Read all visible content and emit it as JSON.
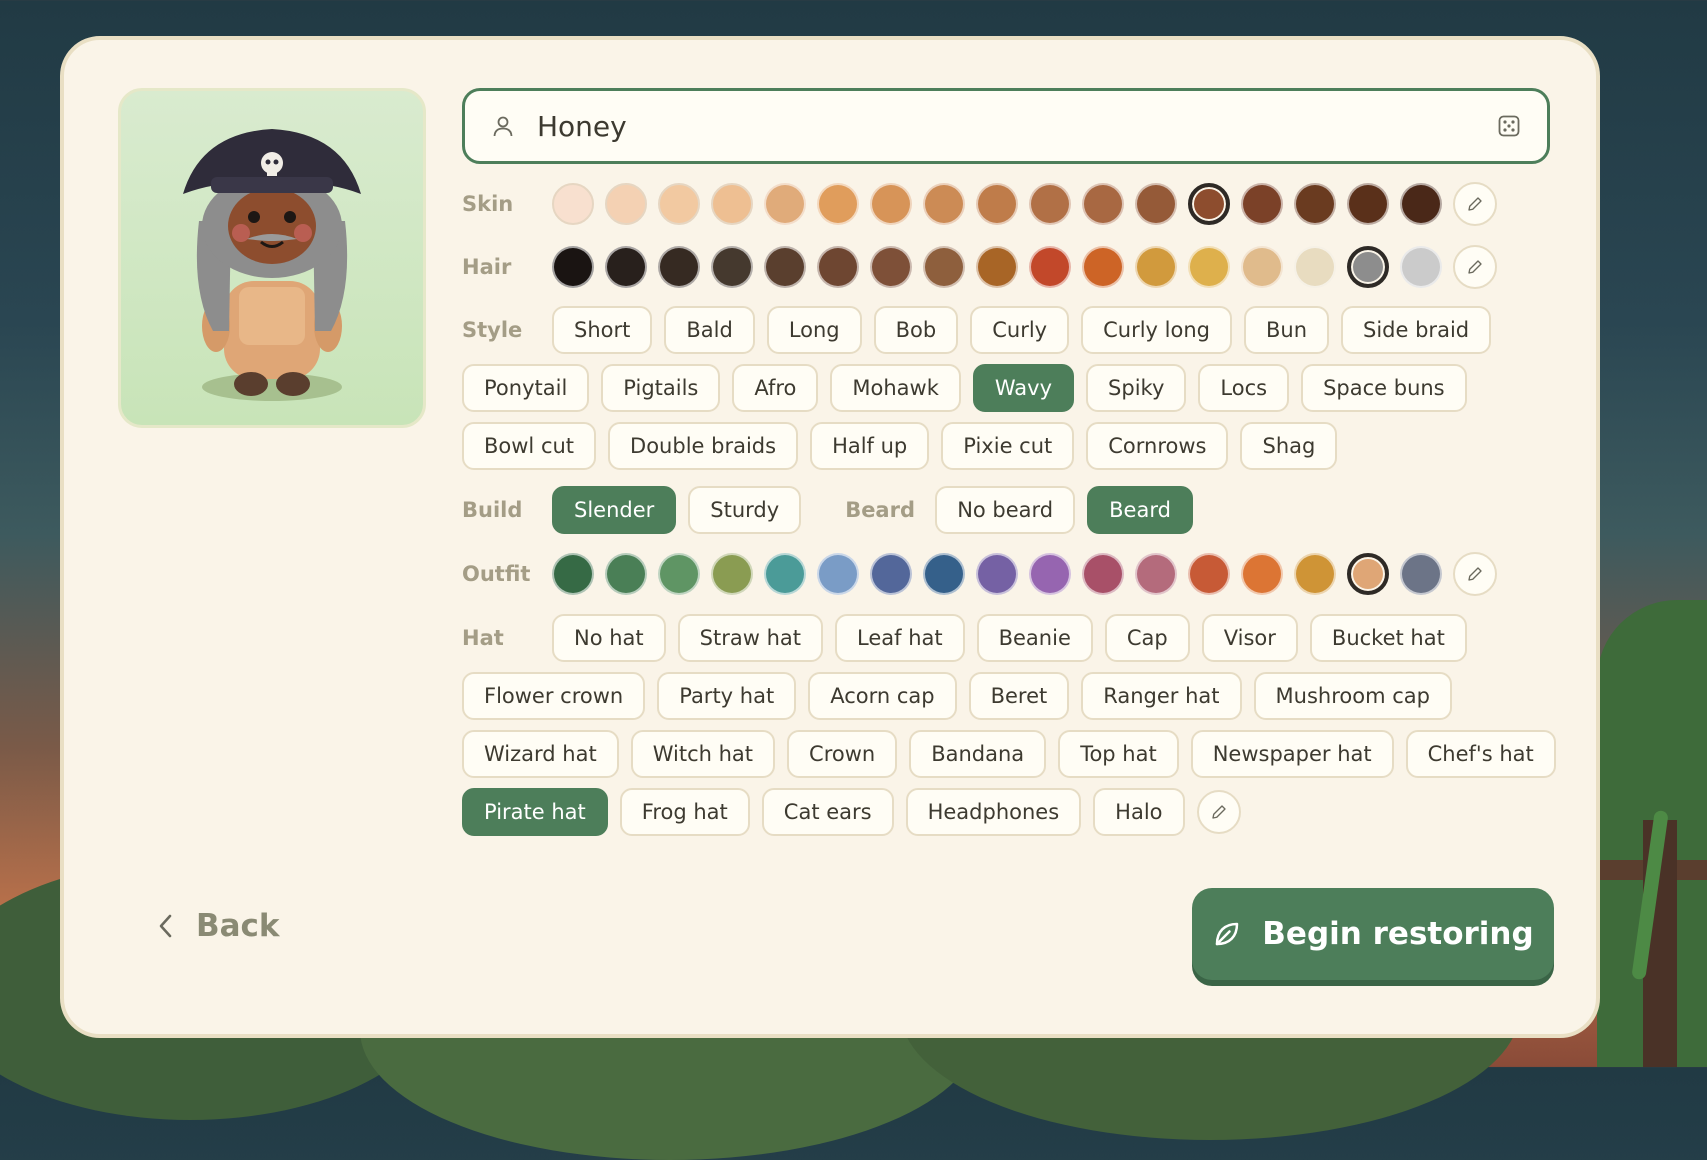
{
  "name": {
    "value": "Honey"
  },
  "skin": {
    "label": "Skin",
    "colors": [
      "#f8e0cf",
      "#f4d1b3",
      "#f2c9a1",
      "#eebf92",
      "#e0ab7a",
      "#e09d5c",
      "#d79458",
      "#cc8b55",
      "#bf7c4a",
      "#b17046",
      "#a86842",
      "#955a38",
      "#8d4d2e",
      "#7b4128",
      "#6a3b20",
      "#5a301a",
      "#4a2818"
    ],
    "selected": 12
  },
  "hair": {
    "label": "Hair",
    "colors": [
      "#1a1412",
      "#28201c",
      "#362a22",
      "#45392e",
      "#5a3f2e",
      "#6e4631",
      "#7e5038",
      "#8e5f3d",
      "#a86526",
      "#c2482a",
      "#cd6426",
      "#d19a3d",
      "#deb04c",
      "#e0bb8c",
      "#e8dcc0",
      "#8d8d8d",
      "#cbcbcb"
    ],
    "selected": 15
  },
  "style": {
    "label": "Style",
    "rows": [
      [
        "Short",
        "Bald",
        "Long",
        "Bob",
        "Curly",
        "Curly long",
        "Bun",
        "Side braid"
      ],
      [
        "Ponytail",
        "Pigtails",
        "Afro",
        "Mohawk",
        "Wavy",
        "Spiky",
        "Locs",
        "Space buns"
      ],
      [
        "Bowl cut",
        "Double braids",
        "Half up",
        "Pixie cut",
        "Cornrows",
        "Shag"
      ]
    ],
    "selected": "Wavy"
  },
  "build": {
    "label": "Build",
    "options": [
      "Slender",
      "Sturdy"
    ],
    "selected": "Slender"
  },
  "beard": {
    "label": "Beard",
    "options": [
      "No beard",
      "Beard"
    ],
    "selected": "Beard"
  },
  "outfit": {
    "label": "Outfit",
    "colors": [
      "#366a45",
      "#4a7f56",
      "#5f9564",
      "#8a9c52",
      "#4b9b98",
      "#7a9cc6",
      "#53679a",
      "#35608a",
      "#7561a4",
      "#9665b0",
      "#a85068",
      "#b46b7c",
      "#c75a36",
      "#dc7534",
      "#cf9436",
      "#dfa676",
      "#6c7487"
    ],
    "selected": 15
  },
  "hat": {
    "label": "Hat",
    "rows": [
      [
        "No hat",
        "Straw hat",
        "Leaf hat",
        "Beanie",
        "Cap",
        "Visor",
        "Bucket hat"
      ],
      [
        "Flower crown",
        "Party hat",
        "Acorn cap",
        "Beret",
        "Ranger hat",
        "Mushroom cap"
      ],
      [
        "Wizard hat",
        "Witch hat",
        "Crown",
        "Bandana",
        "Top hat",
        "Newspaper hat",
        "Chef's hat"
      ],
      [
        "Pirate hat",
        "Frog hat",
        "Cat ears",
        "Headphones",
        "Halo"
      ]
    ],
    "selected": "Pirate hat"
  },
  "footer": {
    "back_label": "Back",
    "begin_label": "Begin restoring"
  },
  "icons": {
    "name": "user-icon",
    "random": "dice-icon",
    "edit": "pencil-icon",
    "back": "chevron-left-icon",
    "begin": "leaf-icon"
  },
  "accent": "#4d7e5a"
}
